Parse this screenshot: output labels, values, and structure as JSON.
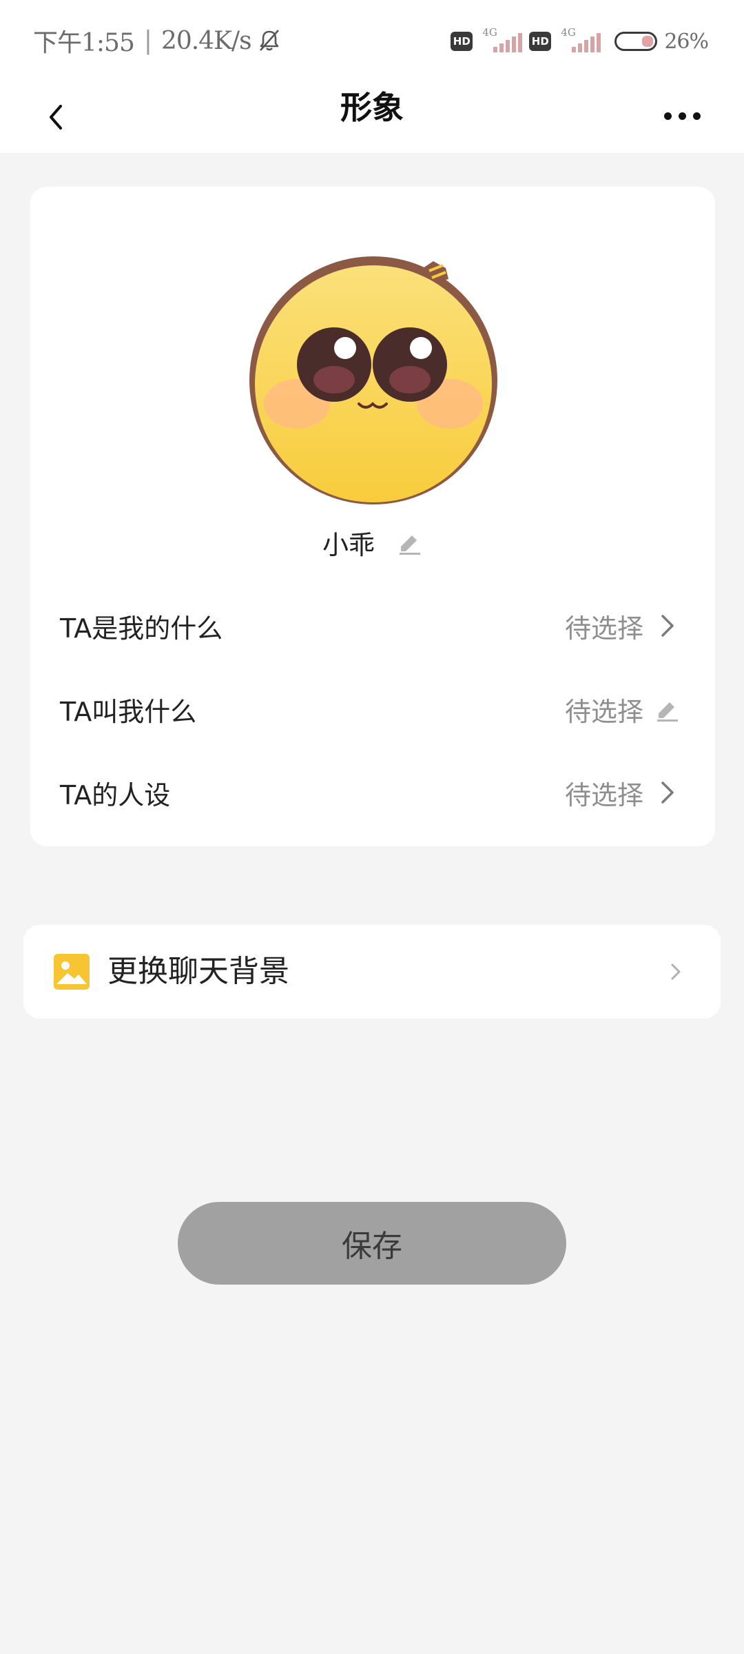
{
  "status_bar": {
    "time": "下午1:55",
    "network_speed": "20.4K/s",
    "hd_badge": "HD",
    "network_type": "4G",
    "battery_percent": "26%",
    "battery_level": 0.26,
    "icons": [
      "bell-off-icon",
      "signal-icon",
      "battery-icon"
    ]
  },
  "nav": {
    "title": "形象",
    "back_icon": "chevron-left-icon",
    "more_icon": "more-dots-icon"
  },
  "profile": {
    "avatar": "cute-yellow-face-avatar",
    "name": "小乖",
    "edit_icon": "pencil-icon"
  },
  "options": [
    {
      "label": "TA是我的什么",
      "value": "待选择",
      "icon": "chevron-right-icon"
    },
    {
      "label": "TA叫我什么",
      "value": "待选择",
      "icon": "pencil-icon"
    },
    {
      "label": "TA的人设",
      "value": "待选择",
      "icon": "chevron-right-icon"
    }
  ],
  "background": {
    "label": "更换聊天背景",
    "icon": "image-icon",
    "arrow_icon": "chevron-right-icon"
  },
  "save": {
    "label": "保存"
  },
  "colors": {
    "page_bg": "#f4f4f4",
    "card_bg": "#ffffff",
    "save_bg": "#a1a1a1",
    "image_icon": "#f7c531",
    "avatar_face": "#fad24a",
    "avatar_border": "#8c5a44"
  }
}
